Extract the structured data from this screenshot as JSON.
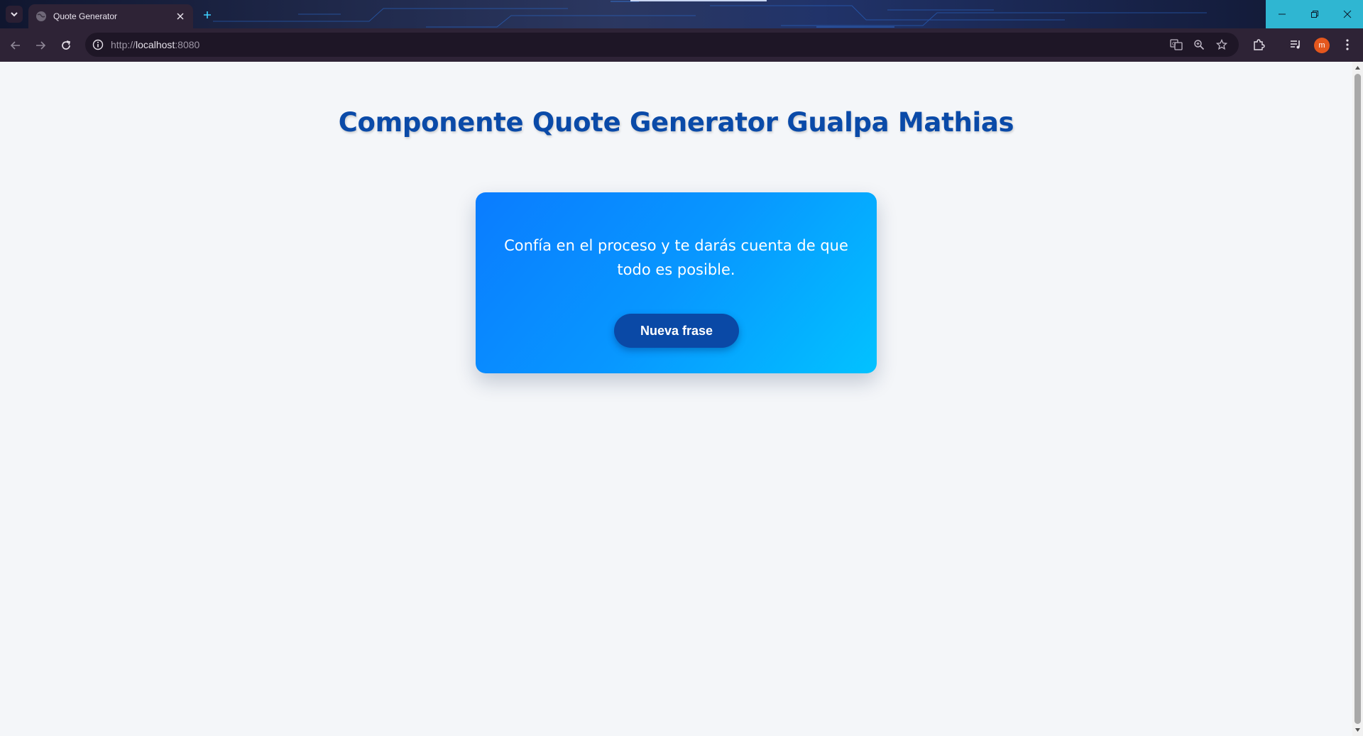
{
  "browser": {
    "tab": {
      "title": "Quote Generator"
    },
    "address_bar": {
      "scheme": "http://",
      "host": "localhost",
      "port": ":8080"
    },
    "profile": {
      "initial": "m",
      "color": "#e4571d"
    }
  },
  "page": {
    "title": "Componente Quote Generator Gualpa Mathias",
    "quote": "Confía en el proceso y te darás cuenta de que todo es posible.",
    "button_label": "Nueva frase"
  },
  "colors": {
    "title": "#0a4aa8",
    "card_gradient_start": "#0a7cff",
    "card_gradient_end": "#02c2ff",
    "button": "#0a49a6",
    "page_background": "#f4f6f9"
  }
}
